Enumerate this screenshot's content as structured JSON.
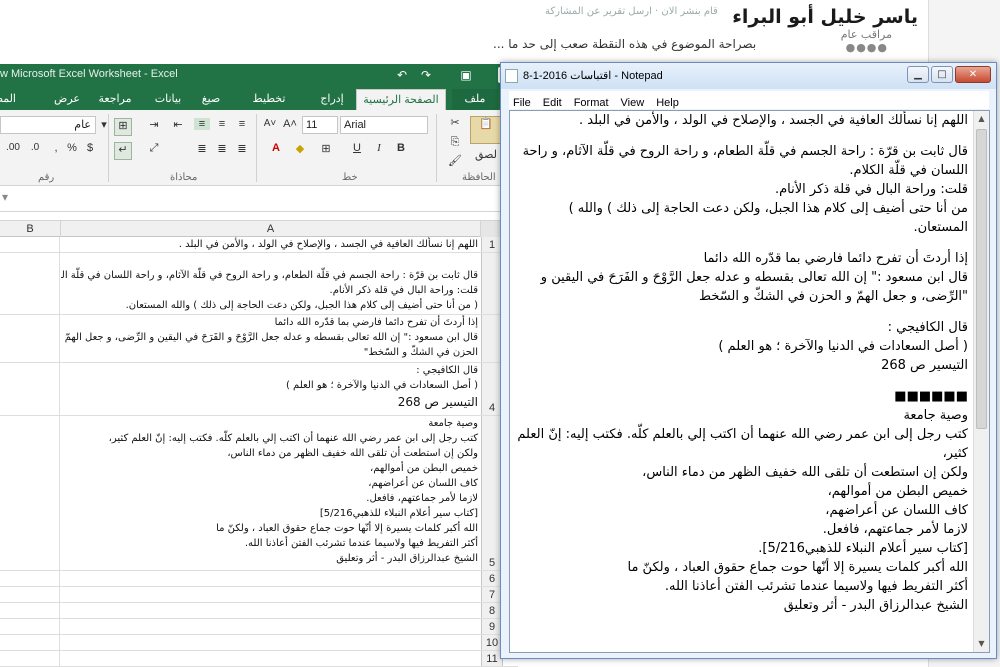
{
  "forum": {
    "name": "ياسر خليل أبو البراء",
    "role": "مراقب عام",
    "rank_dots": "●●●●",
    "notice": "قام بنشر الان · ارسل تقرير عن المشاركة",
    "snippet": "بصراحة الموضوع في هذه النقطة صعب إلى حد ما ..."
  },
  "excel": {
    "title": "w Microsoft Excel Worksheet - Excel",
    "tabs": [
      "ملف",
      "الصفحة الرئيسية",
      "إدراج",
      "تخطيط الصفحة",
      "صيغ",
      "بيانات",
      "مراجعة",
      "عرض",
      "المطور"
    ],
    "ribbon": {
      "font_name": "Arial",
      "font_size": "11",
      "number_format": "عام",
      "paste_label": "لصق",
      "percent": "%",
      "comma": ",",
      "currency": "$",
      "groups": [
        "الحافظة",
        "خط",
        "محاذاة",
        "رقم"
      ]
    },
    "columns": [
      "A",
      "B"
    ],
    "rows": [
      {
        "num": "1",
        "lines": [
          "اللهم إنا نسألك العافية في الجسد ، والإصلاح في الولد ، والأمن في البلد ."
        ]
      },
      {
        "num": "",
        "lines": [
          "",
          "قال ثابت بن قرّة : راحة الجسم في قلّة الطعام، و راحة الروح في قلّة الآثام، و راحة اللسان في قلّة الكلام.",
          "قلت: وراحة البال في قلة ذكر الأنام.",
          "( من أنا حتى أضيف إلى كلام هذا الجبل، ولكن دعت الحاجة إلى ذلك ) والله المستعان."
        ]
      },
      {
        "num": "",
        "lines": [
          "إذا أردتَ أن تفرح دائما فارضي بما قدّره الله دائما",
          "قال ابن مسعود :\" إن الله تعالى بقسطه و عدله جعل الرَّوْحَ و الفَرَحَ في اليقين و الرِّضى، و جعل الهمّ و",
          "الحزن في الشكّ و السّخط\""
        ]
      },
      {
        "num": "4",
        "lines": [
          "قال الكافيجي :",
          "( أصل السعادات في الدنيا والآخرة ؛ هو العلم )",
          "التيسير ص 268"
        ]
      },
      {
        "num": "5",
        "lines": [
          "وصية جامعة",
          "كتب رجل إلى ابن عمر رضي الله عنهما أن اكتب إلي بالعلم كلّه. فكتب إليه: إنّ العلم كثير،",
          "ولكن إن استطعت أن تلقى الله خفيف الظهر من دماء الناس،",
          "خميص البطن من أموالهم،",
          "كاف اللسان عن أعراضهم،",
          "لازما لأمر جماعتهم، فافعل.",
          "[كتاب سير أعلام النبلاء للذهبي5/216]",
          "الله أكبر كلمات يسيرة إلا أنّها حوت جماع حقوق العباد ، ولكنّ ما",
          "أكثر التفريط فيها ولاسيما عندما تشرئب الفتن أعاذنا الله.",
          "الشيخ عبدالرزاق البدر - أثر وتعليق"
        ]
      },
      {
        "num": "6",
        "lines": []
      },
      {
        "num": "7",
        "lines": []
      },
      {
        "num": "8",
        "lines": []
      },
      {
        "num": "9",
        "lines": []
      },
      {
        "num": "10",
        "lines": []
      },
      {
        "num": "11",
        "lines": []
      }
    ]
  },
  "notepad": {
    "title": "اقتباسات 2016-1-8 - Notepad",
    "menu": [
      "File",
      "Edit",
      "Format",
      "View",
      "Help"
    ],
    "lines": [
      "اللهم إنا نسألك العافية في الجسد ، والإصلاح في الولد ، والأمن في البلد .",
      "",
      "قال ثابت بن قرّة : راحة الجسم في قلّة الطعام، و راحة الروح في قلّة الآثام، و راحة",
      "اللسان في قلّة الكلام.",
      "قلت: وراحة البال في قلة ذكر الأنام.",
      "من أنا حتى أضيف إلى كلام هذا الجبل، ولكن دعت الحاجة إلى ذلك ) والله )",
      "المستعان.",
      "",
      "إذا أردتَ أن تفرح دائما فارضي بما قدّره الله دائما",
      "قال ابن مسعود :\" إن الله تعالى بقسطه و عدله جعل الرَّوْحَ و الفَرَحَ في اليقين و",
      "\"الرِّضى، و جعل الهمّ و الحزن في الشكّ و السّخط",
      "",
      "قال الكافيجي :",
      "( أصل السعادات في الدنيا والآخرة ؛ هو العلم )",
      "التيسير ص 268",
      "",
      "■■■■■■",
      "وصية جامعة",
      "كتب رجل إلى ابن عمر رضي الله عنهما أن اكتب إلي بالعلم كلّه. فكتب إليه: إنّ العلم",
      "كثير،",
      "ولكن إن استطعت أن تلقى الله خفيف الظهر من دماء الناس،",
      "خميص البطن من أموالهم،",
      "كاف اللسان عن أعراضهم،",
      "لازما لأمر جماعتهم، فافعل.",
      "[كتاب سير أعلام النبلاء للذهبي5/216].",
      "الله أكبر كلمات يسيرة إلا أنّها حوت جماع حقوق العباد ، ولكنّ ما",
      "أكثر التفريط فيها ولاسيما عندما تشرئب الفتن أعاذنا الله.",
      "الشيخ عبدالرزاق البدر - أثر وتعليق"
    ]
  }
}
